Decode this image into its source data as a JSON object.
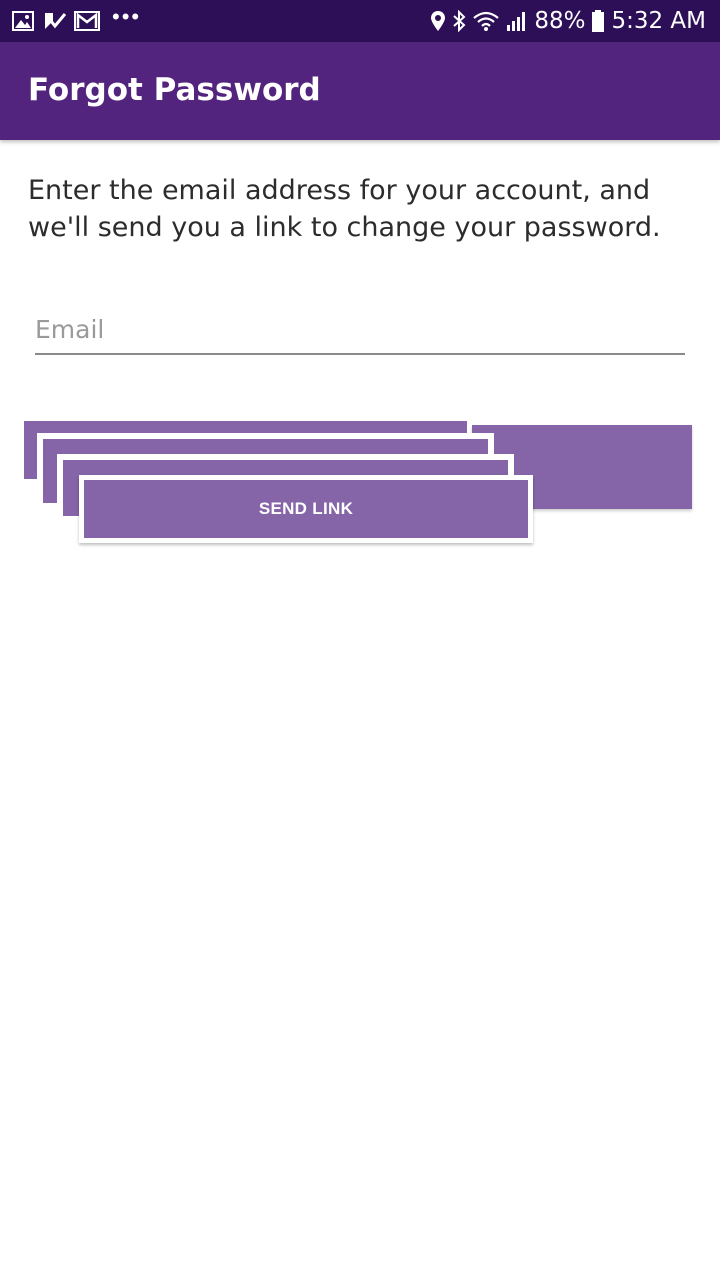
{
  "status_bar": {
    "battery": "88%",
    "time": "5:32 AM",
    "overflow": "•••",
    "icons_left": [
      "gallery-icon",
      "task-check-icon",
      "gmail-icon"
    ],
    "icons_right": [
      "location-icon",
      "bluetooth-icon",
      "wifi-icon",
      "signal-icon",
      "battery-icon"
    ]
  },
  "app_bar": {
    "title": "Forgot Password"
  },
  "main": {
    "instructions": "Enter the email address for your account, and we'll send you a link to change your password.",
    "email_field": {
      "placeholder": "Email",
      "value": ""
    },
    "send_button": {
      "label": "SEND LINK"
    }
  },
  "colors": {
    "status_bar": "#2d0f57",
    "app_bar": "#53247d",
    "button": "#8565a8",
    "text": "#2c2c2c"
  }
}
